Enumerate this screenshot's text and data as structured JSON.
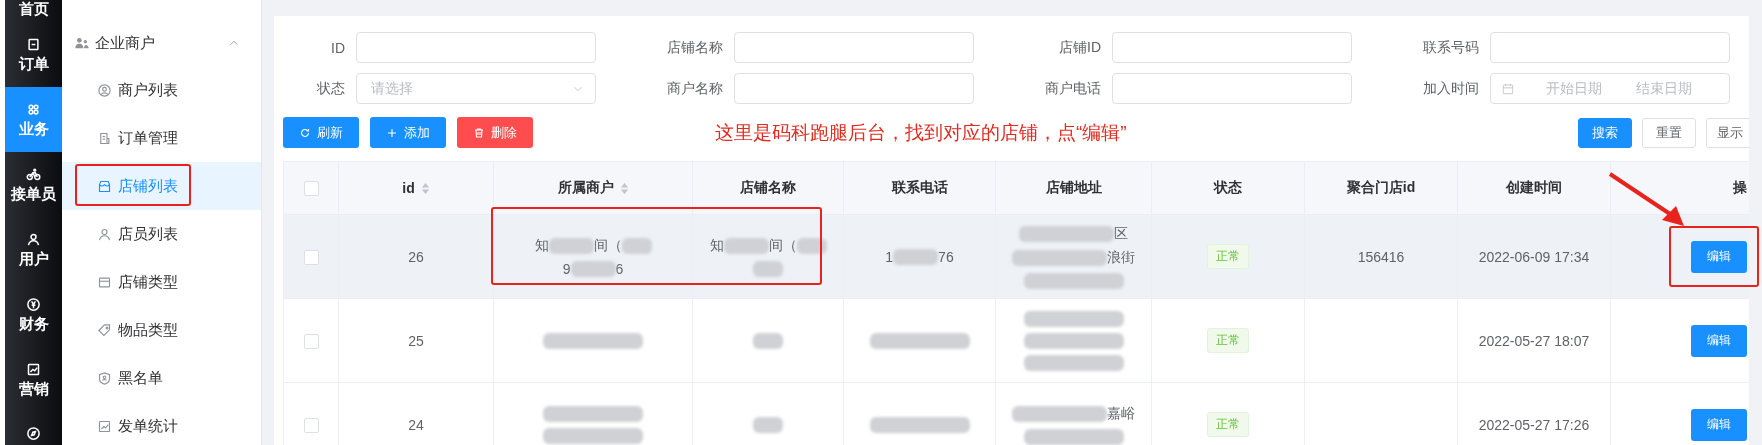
{
  "rail": [
    {
      "label": "首页",
      "selected": false
    },
    {
      "label": "订单",
      "selected": false
    },
    {
      "label": "业务",
      "selected": true
    },
    {
      "label": "接单员",
      "selected": false
    },
    {
      "label": "用户",
      "selected": false
    },
    {
      "label": "财务",
      "selected": false
    },
    {
      "label": "营销",
      "selected": false
    },
    {
      "selected": false
    }
  ],
  "submenu": {
    "group": "企业商户",
    "expanded": true,
    "items": [
      {
        "label": "商户列表",
        "selected": false
      },
      {
        "label": "订单管理",
        "selected": false
      },
      {
        "label": "店铺列表",
        "selected": true
      },
      {
        "label": "店员列表",
        "selected": false
      },
      {
        "label": "店铺类型",
        "selected": false
      },
      {
        "label": "物品类型",
        "selected": false
      },
      {
        "label": "黑名单",
        "selected": false
      },
      {
        "label": "发单统计",
        "selected": false
      }
    ]
  },
  "filters": [
    {
      "label": "ID",
      "kind": "text"
    },
    {
      "label": "店铺名称",
      "kind": "text"
    },
    {
      "label": "店铺ID",
      "kind": "text"
    },
    {
      "label": "联系号码",
      "kind": "text"
    },
    {
      "label": "状态",
      "kind": "select",
      "placeholder": "请选择"
    },
    {
      "label": "商户名称",
      "kind": "text"
    },
    {
      "label": "商户电话",
      "kind": "text"
    },
    {
      "label": "加入时间",
      "kind": "daterange",
      "placeholder_start": "开始日期",
      "placeholder_end": "结束日期"
    }
  ],
  "actions": [
    {
      "label": "刷新",
      "kind": "refresh"
    },
    {
      "label": "添加",
      "kind": "add"
    },
    {
      "label": "删除",
      "kind": "delete"
    }
  ],
  "annotation": "这里是码科跑腿后台，找到对应的店铺，点“编辑”",
  "search_buttons": [
    {
      "label": "搜索",
      "kind": "primary"
    },
    {
      "label": "重置",
      "kind": "plain"
    },
    {
      "label": "显示",
      "kind": "plain"
    }
  ],
  "table": {
    "columns": [
      {
        "kind": "check",
        "checked": false
      },
      {
        "label": "id",
        "sortable": true
      },
      {
        "label": "所属商户",
        "sortable": true
      },
      {
        "label": "店铺名称",
        "sortable": false
      },
      {
        "label": "联系电话",
        "sortable": false
      },
      {
        "label": "店铺地址",
        "sortable": false
      },
      {
        "label": "状态",
        "sortable": false
      },
      {
        "label": "聚合门店id",
        "sortable": false
      },
      {
        "label": "创建时间",
        "sortable": false
      },
      {
        "label": "操",
        "sortable": false
      }
    ],
    "rows": [
      {
        "checked": false,
        "highlighted": true,
        "id": "26",
        "merchant": [
          [
            {
              "kind": "text",
              "text": "知"
            },
            {
              "kind": "blur"
            },
            {
              "kind": "text",
              "text": "间（"
            },
            {
              "kind": "blur"
            }
          ],
          [
            {
              "kind": "text",
              "text": "9"
            },
            {
              "kind": "blur"
            },
            {
              "kind": "text",
              "text": "6"
            }
          ]
        ],
        "store": [
          [
            {
              "kind": "text",
              "text": "知"
            },
            {
              "kind": "blur"
            },
            {
              "kind": "text",
              "text": "间（"
            },
            {
              "kind": "blur"
            }
          ],
          [
            {
              "kind": "blur"
            }
          ]
        ],
        "phone": [
          [
            {
              "kind": "text",
              "text": "1"
            },
            {
              "kind": "blur"
            },
            {
              "kind": "text",
              "text": "76"
            }
          ]
        ],
        "address": [
          [
            {
              "kind": "blur"
            },
            {
              "kind": "text",
              "text": "区"
            }
          ],
          [
            {
              "kind": "blur"
            },
            {
              "kind": "text",
              "text": "浪街"
            }
          ],
          [
            {
              "kind": "blur"
            }
          ]
        ],
        "status": {
          "text": "正常",
          "kind": "success"
        },
        "aggregate_id": "156416",
        "created": "2022-06-09 17:34",
        "action": "编辑"
      },
      {
        "checked": false,
        "highlighted": false,
        "id": "25",
        "merchant": [
          [
            {
              "kind": "blur"
            }
          ]
        ],
        "store": [
          [
            {
              "kind": "blur"
            }
          ]
        ],
        "phone": [
          [
            {
              "kind": "blur"
            }
          ]
        ],
        "address": [
          [
            {
              "kind": "blur"
            }
          ],
          [
            {
              "kind": "blur"
            }
          ],
          [
            {
              "kind": "blur"
            }
          ]
        ],
        "status": {
          "text": "正常",
          "kind": "success"
        },
        "created": "2022-05-27 18:07",
        "action": "编辑"
      },
      {
        "checked": false,
        "highlighted": false,
        "id": "24",
        "merchant": [
          [
            {
              "kind": "blur"
            }
          ],
          [
            {
              "kind": "blur"
            }
          ]
        ],
        "store": [
          [
            {
              "kind": "blur"
            }
          ]
        ],
        "phone": [
          [
            {
              "kind": "blur"
            }
          ]
        ],
        "address": [
          [
            {
              "kind": "blur"
            },
            {
              "kind": "text",
              "text": "嘉峪"
            }
          ],
          [
            {
              "kind": "blur"
            }
          ]
        ],
        "status": {
          "text": "正常",
          "kind": "success"
        },
        "created": "2022-05-27 17:26",
        "action": "编辑"
      }
    ]
  }
}
